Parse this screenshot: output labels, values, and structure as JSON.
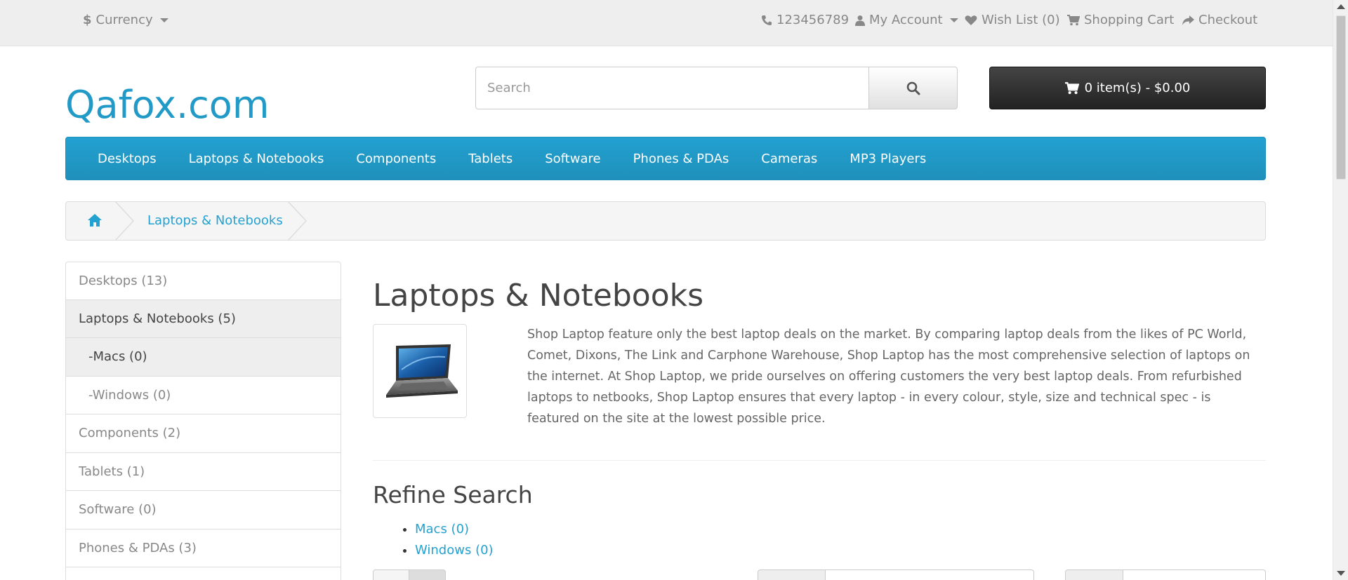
{
  "topbar": {
    "currency_label": "Currency",
    "phone": "123456789",
    "my_account": "My Account",
    "wish_list": "Wish List (0)",
    "shopping_cart": "Shopping Cart",
    "checkout": "Checkout"
  },
  "header": {
    "logo": "Qafox.com",
    "search_placeholder": "Search",
    "cart_label": "0 item(s) - $0.00"
  },
  "menu": {
    "items": [
      "Desktops",
      "Laptops & Notebooks",
      "Components",
      "Tablets",
      "Software",
      "Phones & PDAs",
      "Cameras",
      "MP3 Players"
    ]
  },
  "breadcrumb": {
    "current": "Laptops & Notebooks"
  },
  "sidebar": {
    "items": [
      {
        "label": "Desktops (13)"
      },
      {
        "label": "Laptops & Notebooks (5)"
      },
      {
        "label": "-Macs (0)"
      },
      {
        "label": "-Windows (0)"
      },
      {
        "label": "Components (2)"
      },
      {
        "label": "Tablets (1)"
      },
      {
        "label": "Software (0)"
      },
      {
        "label": "Phones & PDAs (3)"
      }
    ]
  },
  "content": {
    "title": "Laptops & Notebooks",
    "description": "Shop Laptop feature only the best laptop deals on the market. By comparing laptop deals from the likes of PC World, Comet, Dixons, The Link and Carphone Warehouse, Shop Laptop has the most comprehensive selection of laptops on the internet. At Shop Laptop, we pride ourselves on offering customers the very best laptop deals. From refurbished laptops to netbooks, Shop Laptop ensures that every laptop - in every colour, style, size and technical spec - is featured on the site at the lowest possible price.",
    "refine_title": "Refine Search",
    "refine_links": [
      "Macs (0)",
      "Windows (0)"
    ]
  },
  "colors": {
    "brand_blue": "#229ac8",
    "menu_blue": "#23a1d1",
    "cart_dark": "#2b2b2b"
  }
}
